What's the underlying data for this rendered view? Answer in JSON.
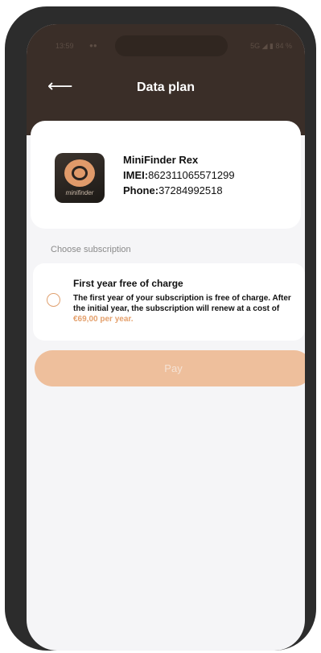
{
  "status_bar": {
    "time": "13:59",
    "indicator": "●●",
    "right": "5G ◢ ▮ 84 %"
  },
  "header": {
    "back_icon": "arrow-left-icon",
    "title": "Data plan"
  },
  "device": {
    "logo_text": "minifinder",
    "name": "MiniFinder Rex",
    "imei_label": "IMEI:",
    "imei_value": "862311065571299",
    "phone_label": "Phone:",
    "phone_value": "37284992518"
  },
  "subscription": {
    "section_label": "Choose subscription",
    "option": {
      "title": "First year free of charge",
      "description": "The first year of your subscription is free of charge. After the initial year, the subscription will renew at a cost of ",
      "price": "€69,00 per year.",
      "selected": false
    }
  },
  "pay_button": {
    "label": "Pay",
    "enabled": false
  },
  "colors": {
    "header_bg": "#3a2e28",
    "accent": "#e4a06c",
    "button_disabled": "#eebf9c",
    "frame": "#2c2c2c"
  }
}
